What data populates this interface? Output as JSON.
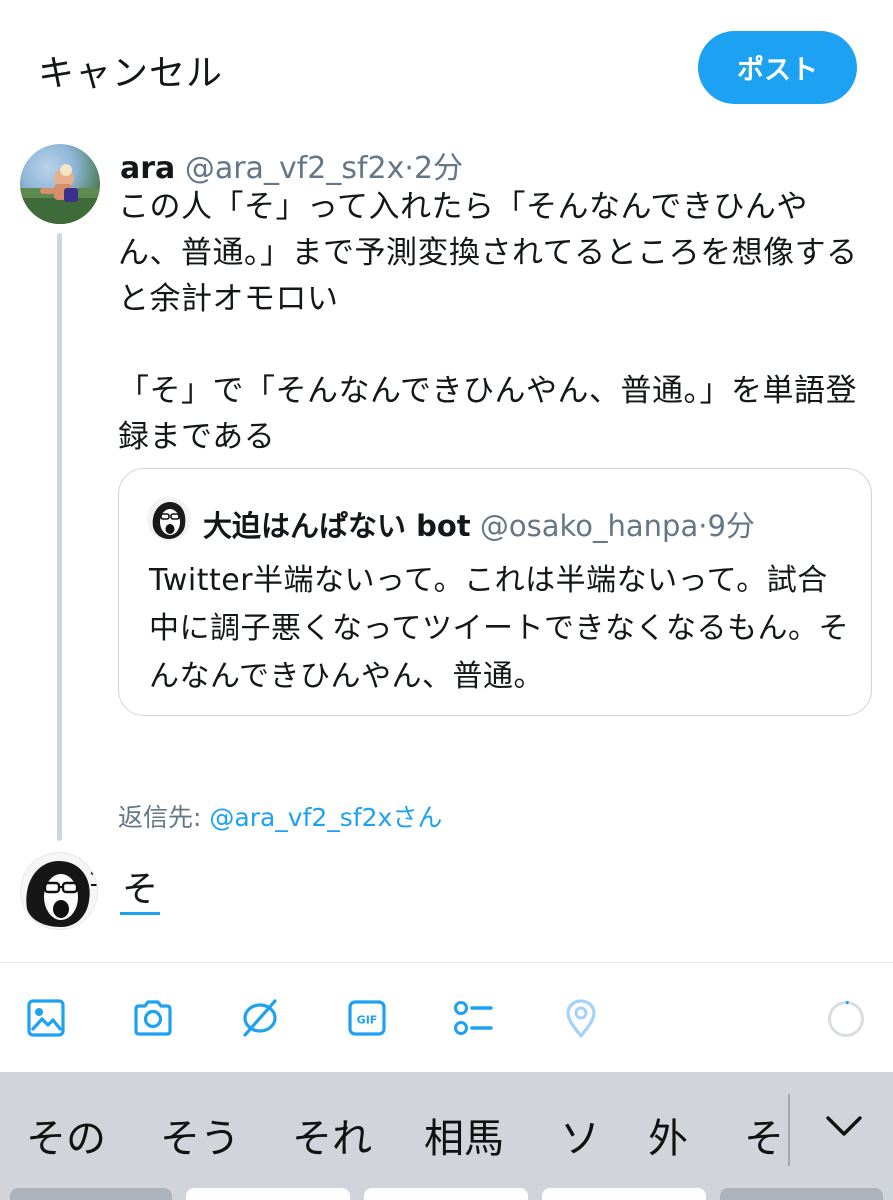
{
  "header": {
    "cancel_label": "キャンセル",
    "post_label": "ポスト"
  },
  "tweet": {
    "name": "ara",
    "handle": "@ara_vf2_sf2x",
    "separator": "·",
    "time": "2分",
    "body": "この人「そ」って入れたら「そんなんできひんやん、普通。」まで予測変換されてるところを想像すると余計オモロい\n\n「そ」で「そんなんできひんやん、普通。」を単語登録まである"
  },
  "quote": {
    "name": "大迫はんぱない bot",
    "handle": "@osako_hanpa",
    "separator": "·",
    "time": "9分",
    "body": "Twitter半端ないって。これは半端ないって。試合中に調子悪くなってツイートできなくなるもん。そんなんできひんやん、普通。"
  },
  "reply": {
    "prefix": "返信先: ",
    "mention": "@ara_vf2_sf2x",
    "suffix": "さん"
  },
  "compose": {
    "text": "そ"
  },
  "toolbar": {
    "icons": [
      "image-icon",
      "camera-icon",
      "gif-search-icon",
      "gif-icon",
      "poll-icon",
      "location-icon"
    ],
    "gif_label": "GIF",
    "accent_color": "#1da1f2",
    "disabled_color": "#a5d2f7"
  },
  "keyboard": {
    "candidates": [
      "その",
      "そう",
      "それ",
      "相馬",
      "ソ",
      "外",
      "そ"
    ]
  }
}
